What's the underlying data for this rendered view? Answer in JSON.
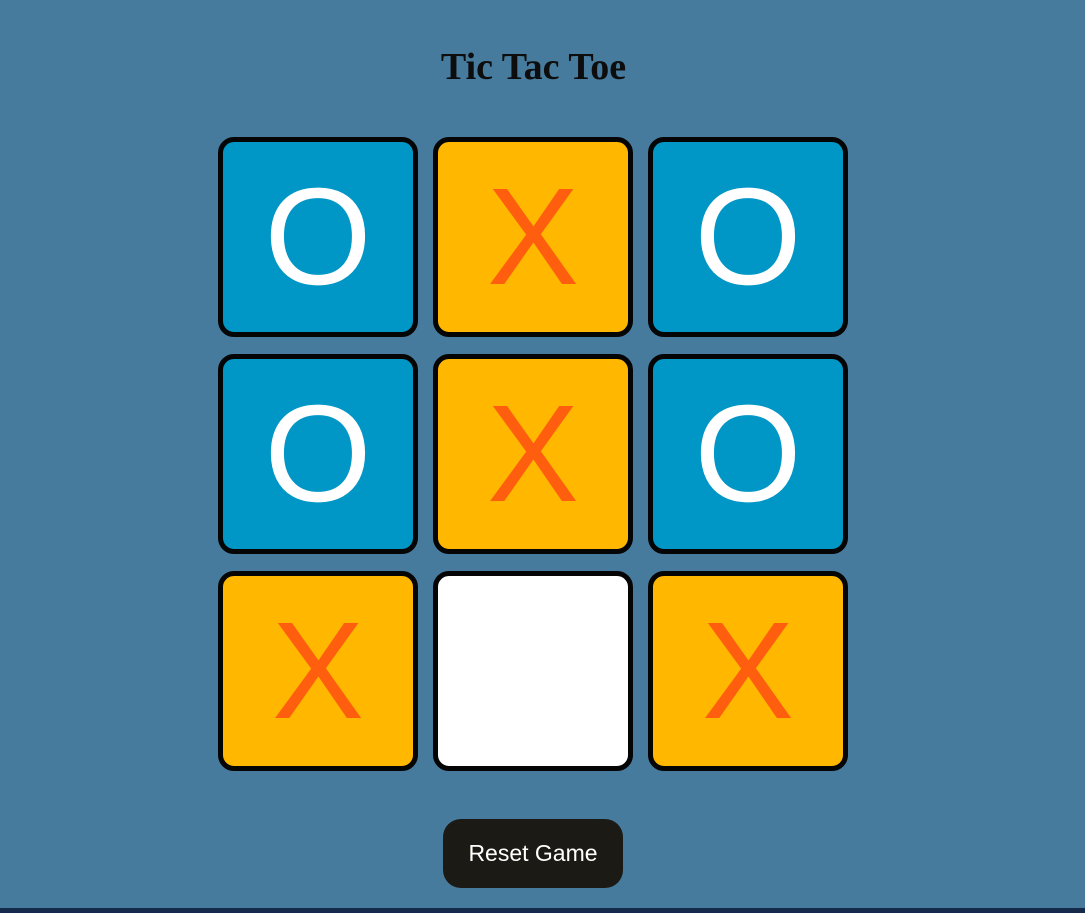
{
  "title": "Tic Tac Toe",
  "board": {
    "cells": [
      "O",
      "X",
      "O",
      "O",
      "X",
      "O",
      "X",
      "",
      "X"
    ]
  },
  "reset_label": "Reset Game",
  "colors": {
    "background": "#477b9d",
    "o_tile": "#0096c6",
    "o_mark": "#ffffff",
    "x_tile": "#ffb700",
    "x_mark": "#ff5e0e",
    "empty_tile": "#ffffff",
    "tile_border": "#050505",
    "button": "#1b1a14",
    "footer_bar": "#15294a"
  }
}
